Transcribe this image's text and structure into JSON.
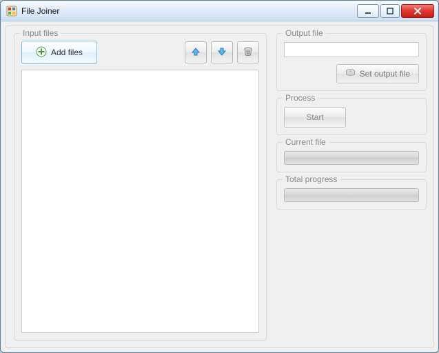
{
  "window": {
    "title": "File Joiner"
  },
  "left": {
    "legend": "Input files",
    "add_files_label": "Add files"
  },
  "right": {
    "output": {
      "legend": "Output file",
      "set_label": "Set output file"
    },
    "process": {
      "legend": "Process",
      "start_label": "Start"
    },
    "current": {
      "legend": "Current file"
    },
    "total": {
      "legend": "Total progress"
    }
  }
}
